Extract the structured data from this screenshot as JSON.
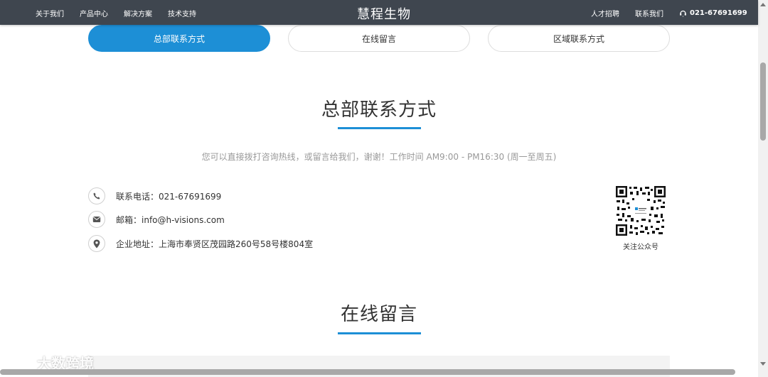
{
  "nav": {
    "left": [
      "关于我们",
      "产品中心",
      "解决方案",
      "技术支持"
    ],
    "logo": "慧程生物",
    "right": [
      "人才招聘",
      "联系我们"
    ],
    "phone": "021-67691699"
  },
  "tabs": [
    {
      "label": "总部联系方式",
      "active": true
    },
    {
      "label": "在线留言",
      "active": false
    },
    {
      "label": "区域联系方式",
      "active": false
    }
  ],
  "headquarters": {
    "title": "总部联系方式",
    "intro": "您可以直接拨打咨询热线，或留言给我们，谢谢！工作时间 AM9:00 - PM16:30 (周一至周五)",
    "contacts": [
      {
        "icon": "phone-icon",
        "text": "联系电话：021-67691699"
      },
      {
        "icon": "mail-icon",
        "text": "邮箱：info@h-visions.com"
      },
      {
        "icon": "location-pin-icon",
        "text": "企业地址：上海市奉贤区茂园路260号58号楼804室"
      }
    ],
    "qr_label": "关注公众号"
  },
  "message": {
    "title": "在线留言"
  },
  "watermark": "大数跨境",
  "colors": {
    "accent": "#1d8fd6",
    "topbar": "#3f464f"
  }
}
